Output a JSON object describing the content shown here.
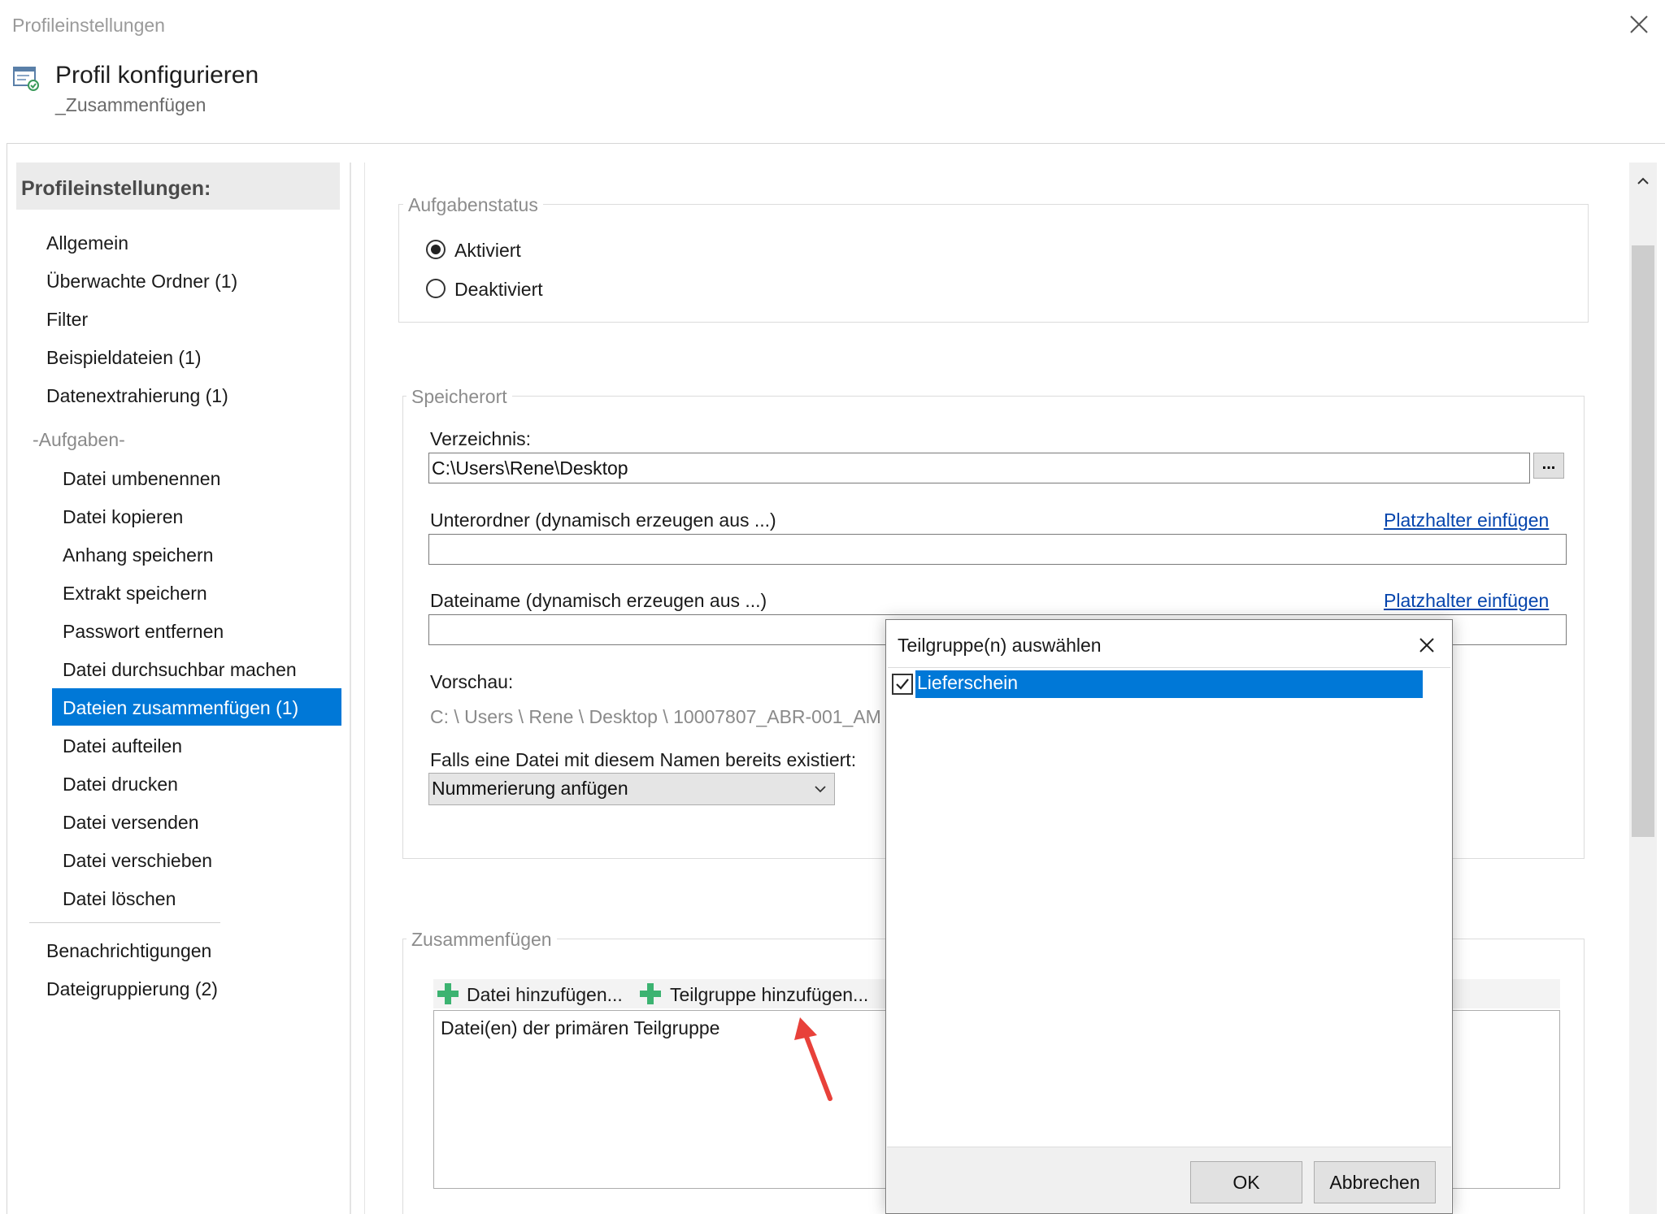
{
  "window": {
    "title": "Profileinstellungen",
    "header_title": "Profil konfigurieren",
    "header_subtitle": "_Zusammenfügen"
  },
  "sidebar": {
    "heading": "Profileinstellungen:",
    "top_items": [
      "Allgemein",
      "Überwachte Ordner (1)",
      "Filter",
      "Beispieldateien (1)",
      "Datenextrahierung (1)"
    ],
    "group_label": "-Aufgaben-",
    "task_items": [
      "Datei umbenennen",
      "Datei kopieren",
      "Anhang speichern",
      "Extrakt speichern",
      "Passwort entfernen",
      "Datei durchsuchbar machen",
      "Dateien zusammenfügen (1)",
      "Datei aufteilen",
      "Datei drucken",
      "Datei versenden",
      "Datei verschieben",
      "Datei löschen"
    ],
    "bottom_items": [
      "Benachrichtigungen",
      "Dateigruppierung (2)"
    ]
  },
  "aufgabenstatus": {
    "title": "Aufgabenstatus",
    "option_active": "Aktiviert",
    "option_inactive": "Deaktiviert"
  },
  "speicherort": {
    "title": "Speicherort",
    "verzeichnis_label": "Verzeichnis:",
    "verzeichnis_value": "C:\\Users\\Rene\\Desktop",
    "browse_label": "...",
    "unterordner_label": "Unterordner (dynamisch erzeugen aus ...)",
    "unterordner_link": "Platzhalter einfügen",
    "dateiname_label": "Dateiname (dynamisch erzeugen aus ...)",
    "dateiname_link": "Platzhalter einfügen",
    "vorschau_label": "Vorschau:",
    "vorschau_value": "C: \\ Users \\ Rene \\ Desktop \\ 10007807_ABR-001_AM",
    "exists_label": "Falls eine Datei mit diesem Namen bereits existiert:",
    "exists_selected": "Nummerierung anfügen"
  },
  "zusammenfuegen": {
    "title": "Zusammenfügen",
    "add_file": "Datei hinzufügen...",
    "add_subgroup": "Teilgruppe hinzufügen...",
    "list_item": "Datei(en) der primären Teilgruppe"
  },
  "dialog": {
    "title": "Teilgruppe(n) auswählen",
    "items": [
      "Lieferschein"
    ],
    "ok_label": "OK",
    "cancel_label": "Abbrechen"
  },
  "colors": {
    "selection": "#0078d7",
    "link": "#0645ad",
    "plus": "#3cb371",
    "annotation_arrow": "#e8413a"
  }
}
